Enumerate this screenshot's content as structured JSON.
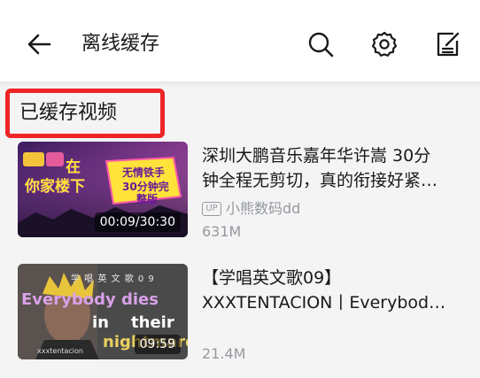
{
  "header": {
    "title": "离线缓存",
    "icons": [
      "back-arrow-icon",
      "search-icon",
      "gear-icon",
      "edit-icon"
    ]
  },
  "section": {
    "title": "已缓存视频"
  },
  "colors": {
    "highlight": "#ee2526",
    "meta_text": "#9499a0",
    "title_text": "#18191c"
  },
  "videos": [
    {
      "title_line1": "深圳大鹏音乐嘉年华许嵩 30分",
      "title_line2": "钟全程无剪切，真的衔接好紧…",
      "up_badge": "UP",
      "uploader": "小熊数码dd",
      "size": "631M",
      "duration": "00:09/30:30",
      "thumb_text_left_1": "在",
      "thumb_text_left_2": "你家楼下",
      "thumb_text_right_1": "无情铁手",
      "thumb_text_right_2": "30分钟完",
      "thumb_text_right_3": "整版"
    },
    {
      "title_line1": "【学唱英文歌09】",
      "title_line2": "XXXTENTACION丨Everybod…",
      "size": "21.4M",
      "duration": "09:59",
      "thumb_header": "学 唱 英 文 歌 0 9",
      "thumb_line1": "Everybody dies",
      "thumb_line2": "in    their",
      "thumb_line3": "nightmares",
      "thumb_caption": "xxxtentacion"
    }
  ]
}
